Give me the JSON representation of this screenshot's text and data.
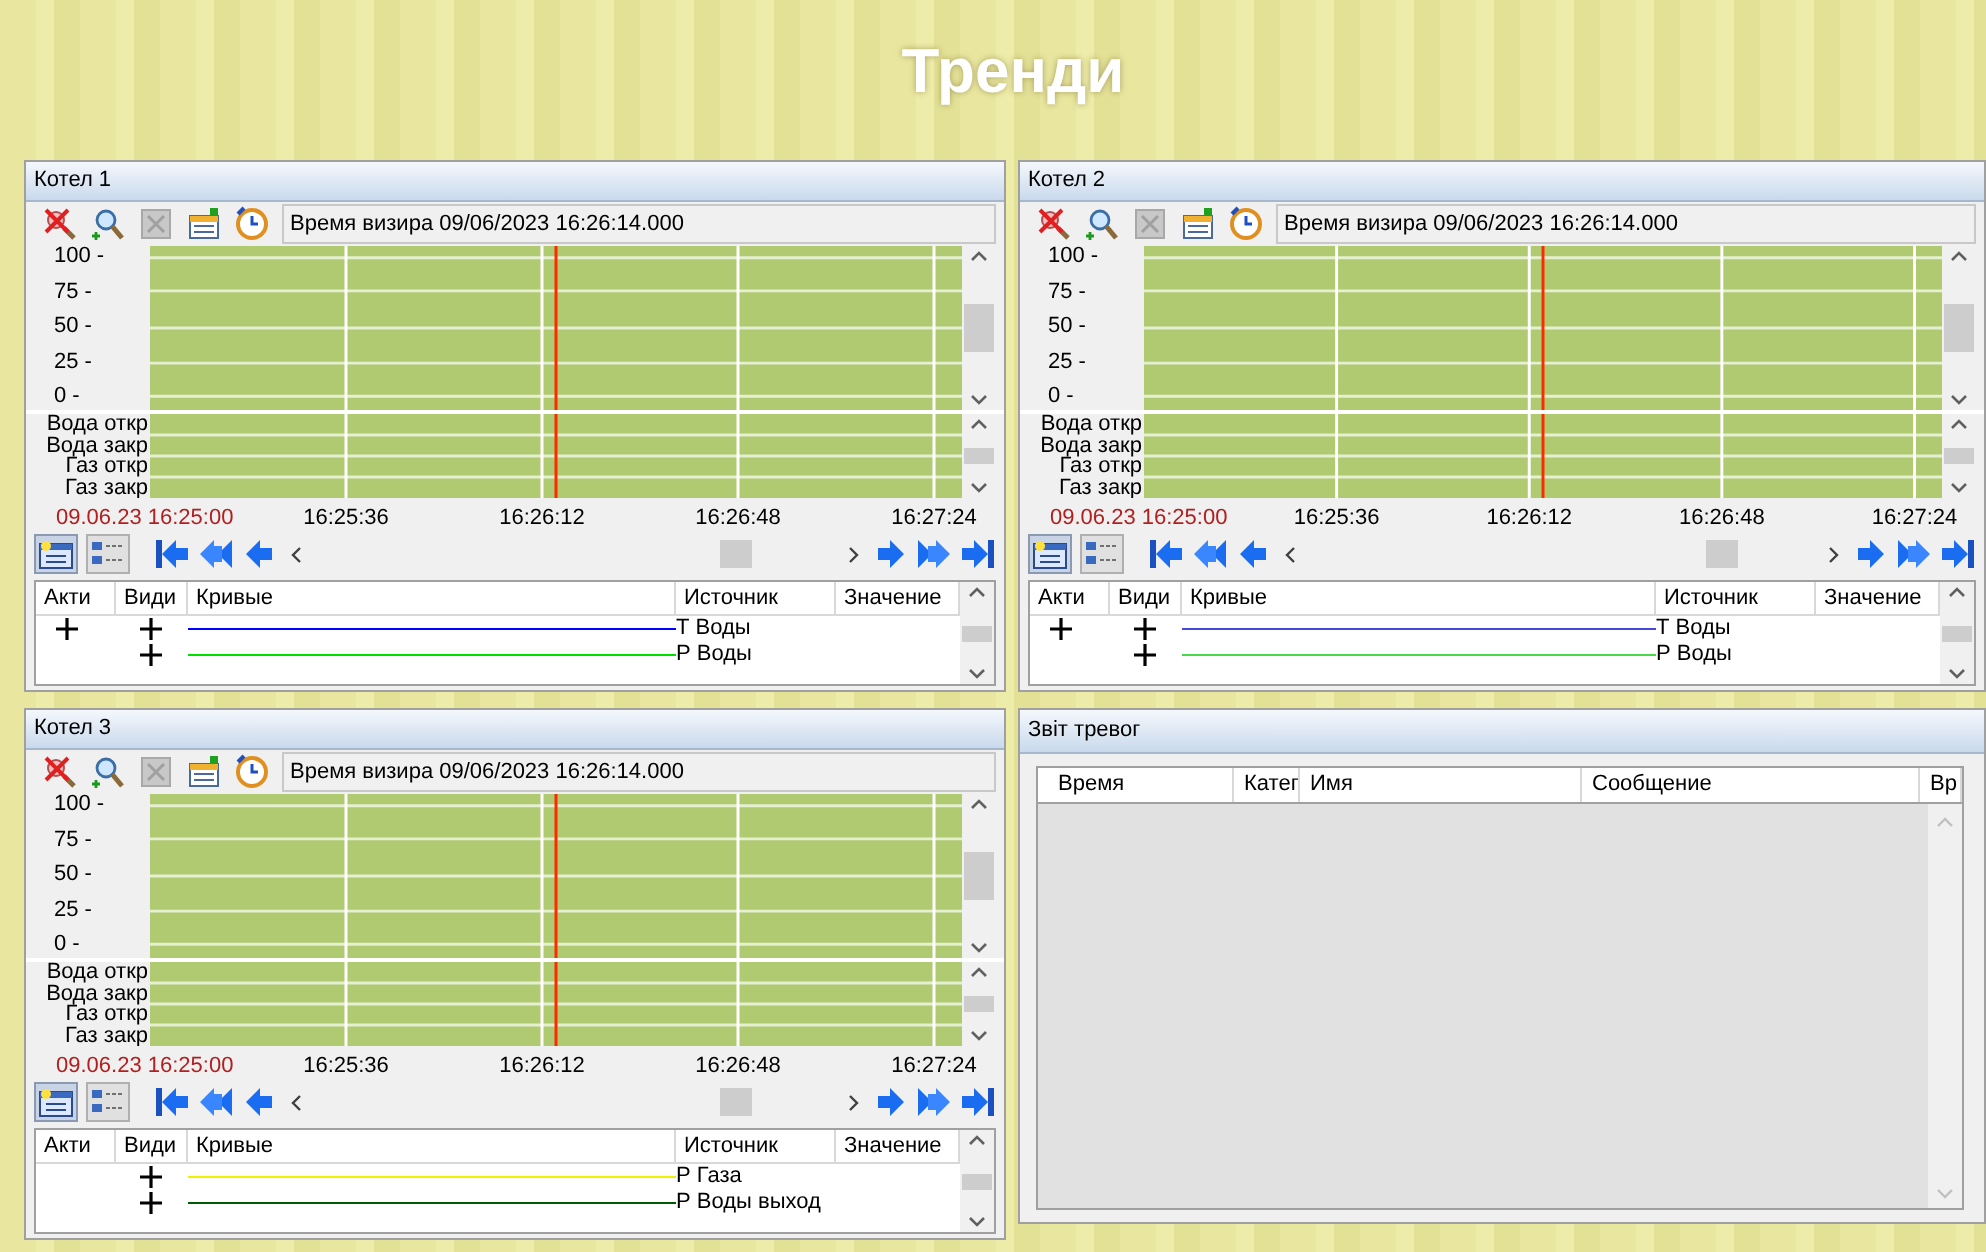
{
  "title": "Тренди",
  "trend_panels": [
    {
      "title": "Котел 1",
      "cursor_time": "Время визира 09/06/2023 16:26:14.000",
      "y_ticks": [
        "100 -",
        "75 -",
        "50 -",
        "25 -",
        "0 -"
      ],
      "discrete_labels": [
        "Вода откр",
        "Вода закр",
        "Газ откр",
        "Газ закр"
      ],
      "start_time": "09.06.23 16:25:00",
      "time_ticks": [
        "16:25:36",
        "16:26:12",
        "16:26:48",
        "16:27:24"
      ],
      "legend_columns": [
        "Акти",
        "Види",
        "Кривые",
        "Источник",
        "Значение"
      ],
      "curves": [
        {
          "active": true,
          "visible": true,
          "color": "#0000ff",
          "source": "Т Воды"
        },
        {
          "active": false,
          "visible": true,
          "color": "#00e000",
          "source": "Р Воды"
        }
      ]
    },
    {
      "title": "Котел 2",
      "cursor_time": "Время визира 09/06/2023 16:26:14.000",
      "y_ticks": [
        "100 -",
        "75 -",
        "50 -",
        "25 -",
        "0 -"
      ],
      "discrete_labels": [
        "Вода откр",
        "Вода закр",
        "Газ откр",
        "Газ закр"
      ],
      "start_time": "09.06.23 16:25:00",
      "time_ticks": [
        "16:25:36",
        "16:26:12",
        "16:26:48",
        "16:27:24"
      ],
      "legend_columns": [
        "Акти",
        "Види",
        "Кривые",
        "Источник",
        "Значение"
      ],
      "curves": [
        {
          "active": true,
          "visible": true,
          "color": "#4848d8",
          "source": "Т Воды"
        },
        {
          "active": false,
          "visible": true,
          "color": "#48d848",
          "source": "Р Воды"
        }
      ]
    },
    {
      "title": "Котел 3",
      "cursor_time": "Время визира 09/06/2023 16:26:14.000",
      "y_ticks": [
        "100 -",
        "75 -",
        "50 -",
        "25 -",
        "0 -"
      ],
      "discrete_labels": [
        "Вода откр",
        "Вода закр",
        "Газ откр",
        "Газ закр"
      ],
      "start_time": "09.06.23 16:25:00",
      "time_ticks": [
        "16:25:36",
        "16:26:12",
        "16:26:48",
        "16:27:24"
      ],
      "legend_columns": [
        "Акти",
        "Види",
        "Кривые",
        "Источник",
        "Значение"
      ],
      "curves": [
        {
          "active": false,
          "visible": true,
          "color": "#f0f000",
          "source": "Р Газа"
        },
        {
          "active": false,
          "visible": true,
          "color": "#005a00",
          "source": "Р Воды выход"
        }
      ]
    }
  ],
  "alarm_panel": {
    "title": "Звіт тревог",
    "columns": [
      "Время",
      "Катег",
      "Имя",
      "Сообщение",
      "Вр"
    ]
  }
}
